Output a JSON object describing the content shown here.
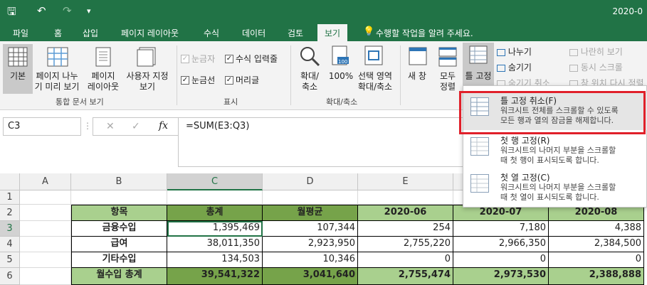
{
  "title_text": "2020-0",
  "qat": {
    "save": "🖫",
    "undo": "↶",
    "redo": "↷",
    "more": "▾"
  },
  "tabs": [
    {
      "label": "파일"
    },
    {
      "label": "홈"
    },
    {
      "label": "삽입"
    },
    {
      "label": "페이지 레이아웃"
    },
    {
      "label": "수식"
    },
    {
      "label": "데이터"
    },
    {
      "label": "검토"
    },
    {
      "label": "보기"
    }
  ],
  "tell_me": "수행할 작업을 알려 주세요.",
  "ribbon": {
    "views": {
      "normal": "기본",
      "page_break": [
        "페이지 나누",
        "기 미리 보기"
      ],
      "page_layout": [
        "페이지",
        "레이아웃"
      ],
      "custom": [
        "사용자 지정",
        "보기"
      ],
      "group_label": "통합 문서 보기"
    },
    "show": {
      "ruler": "눈금자",
      "formula_bar": "수식 입력줄",
      "gridlines": "눈금선",
      "headings": "머리글",
      "group_label": "표시"
    },
    "zoom": {
      "zoom": [
        "확대/",
        "축소"
      ],
      "hundred": "100%",
      "selection": [
        "선택 영역",
        "확대/축소"
      ],
      "group_label": "확대/축소"
    },
    "window": {
      "new_window": "새 창",
      "arrange": [
        "모두",
        "정렬"
      ],
      "freeze": "틀 고정",
      "split": "나누기",
      "hide": "숨기기",
      "unhide": "숨기기 취소",
      "side_by_side": "나란히 보기",
      "sync_scroll": "동시 스크롤",
      "reset_pos": "창 위치 다시 정렬"
    }
  },
  "formula_bar": {
    "name_box": "C3",
    "cancel": "✕",
    "enter": "✓",
    "fx": "fx",
    "formula": "=SUM(E3:Q3)"
  },
  "columns": [
    "A",
    "B",
    "C",
    "D",
    "E",
    "F"
  ],
  "rows": [
    "1",
    "2",
    "3",
    "4",
    "5",
    "6"
  ],
  "table": {
    "headers": [
      "항목",
      "총계",
      "월평균",
      "2020-06",
      "2020-07",
      "2020-08"
    ],
    "rows": [
      [
        "금융수입",
        "1,395,469",
        "107,344",
        "254",
        "7,180",
        "4,388"
      ],
      [
        "급여",
        "38,011,350",
        "2,923,950",
        "2,755,220",
        "2,966,350",
        "2,384,500"
      ],
      [
        "기타수입",
        "134,503",
        "10,346",
        "0",
        "0",
        "0"
      ],
      [
        "월수입 총계",
        "39,541,322",
        "3,041,640",
        "2,755,474",
        "2,973,530",
        "2,388,888"
      ]
    ]
  },
  "dropdown": [
    {
      "title": "틀 고정 취소(F)",
      "desc": [
        "워크시트 전체를 스크롤할 수 있도록",
        "모든 행과 열의 잠금을 해제합니다."
      ]
    },
    {
      "title": "첫 행 고정(R)",
      "desc": [
        "워크시트의 나머지 부분을 스크롤할",
        "때 첫 행이 표시되도록 합니다."
      ]
    },
    {
      "title": "첫 열 고정(C)",
      "desc": [
        "워크시트의 나머지 부분을 스크롤할",
        "때 첫 열이 표시되도록 합니다."
      ]
    }
  ],
  "colors": {
    "excel_green": "#217346",
    "header_dark": "#76a34a",
    "header_light": "#a9d08e",
    "highlight": "#e0202a"
  }
}
